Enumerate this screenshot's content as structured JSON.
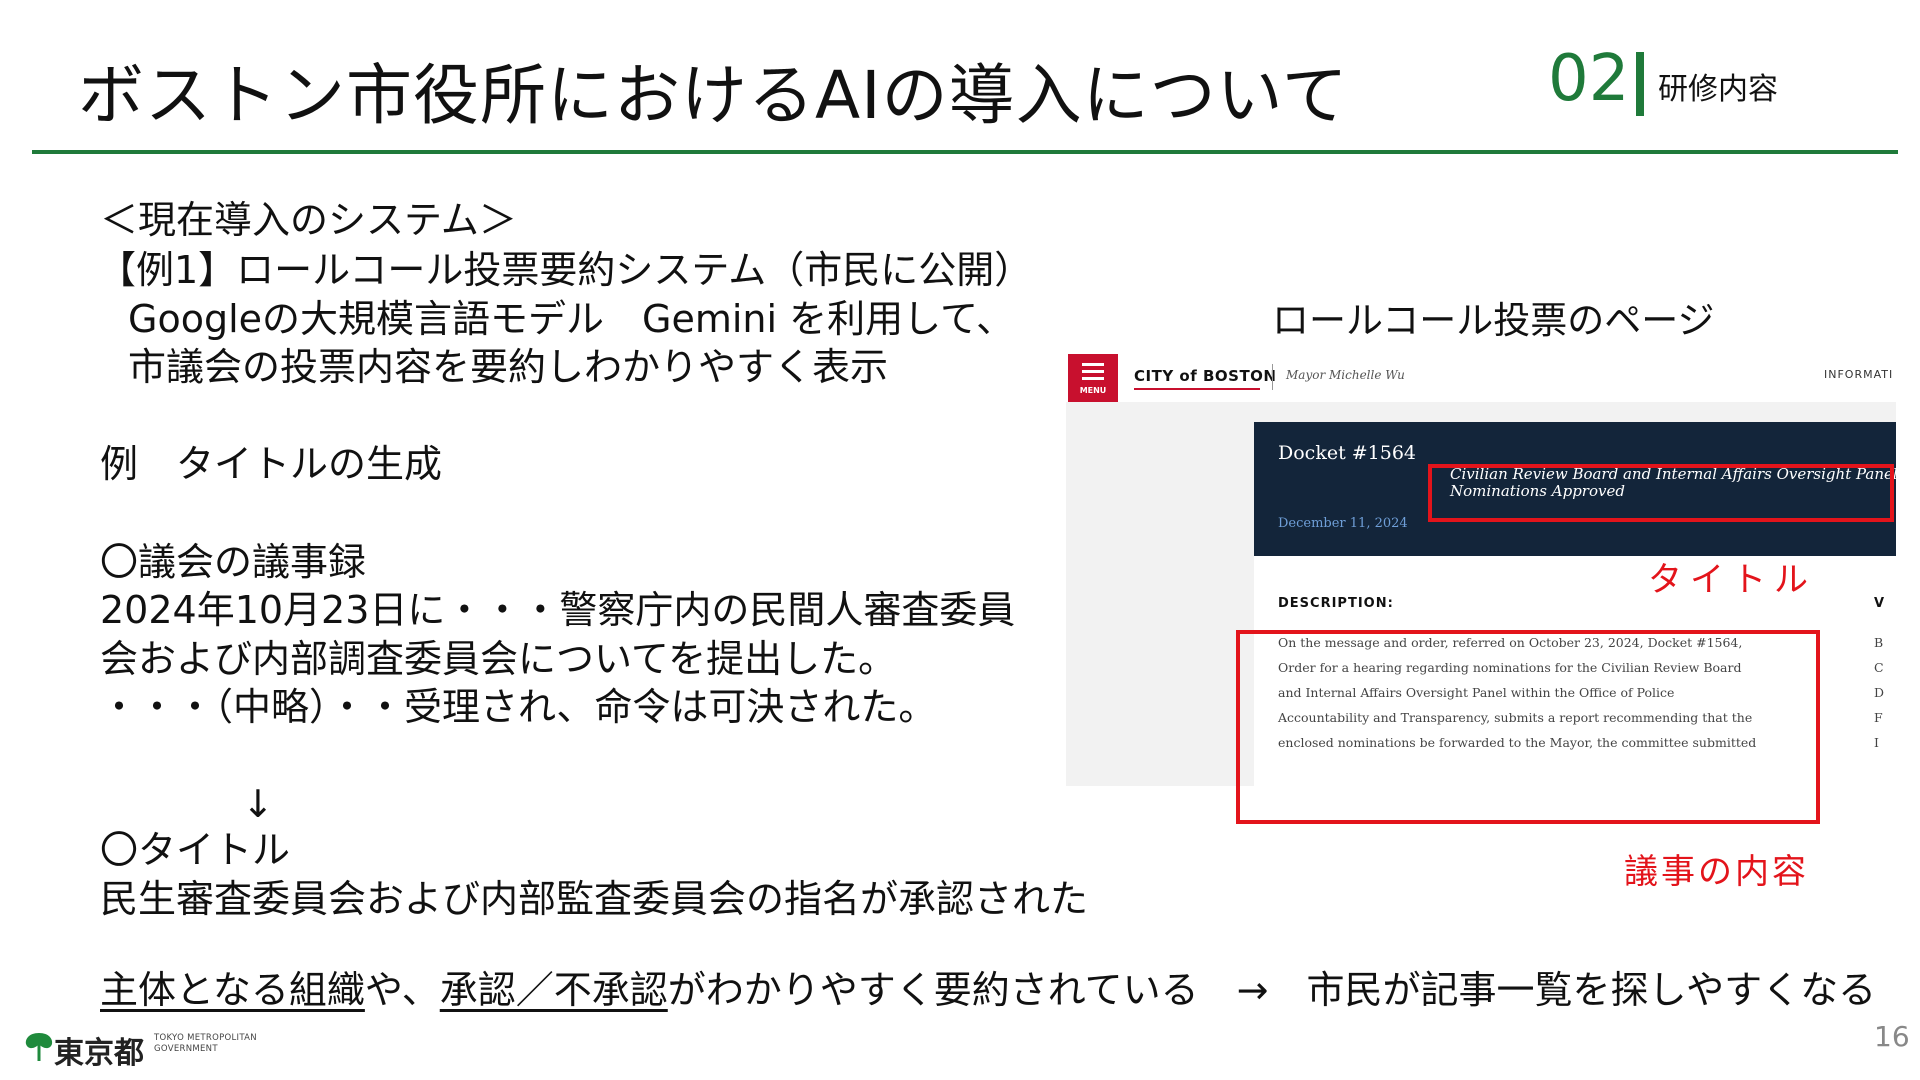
{
  "header": {
    "title": "ボストン市役所におけるAIの導入について",
    "section_number": "02",
    "section_label": "研修内容"
  },
  "body": {
    "heading": "＜現在導入のシステム＞",
    "example1_title": "【例1】ロールコール投票要約システム（市民に公開）",
    "example1_desc_1": "Googleの大規模言語モデル　Gemini を利用して、",
    "example1_desc_2": "市議会の投票内容を要約しわかりやすく表示",
    "example_label": "例　タイトルの生成",
    "minutes_heading": "〇議会の議事録",
    "minutes_line_1": "2024年10月23日に・・・警察庁内の民間人審査委員",
    "minutes_line_2": "会および内部調査委員会についてを提出した。",
    "minutes_line_3": "・・・（中略）・・受理され、命令は可決された。",
    "arrow": "↓",
    "title_heading": "〇タイトル",
    "title_result": "民生審査委員会および内部監査委員会の指名が承認された",
    "conclusion": {
      "part1": "主体となる組織",
      "part2": "や、",
      "part3": "承認／不承認",
      "part4": "がわかりやすく要約されている　→　市民が記事一覧を探しやすくなる"
    }
  },
  "screenshot": {
    "caption": "ロールコール投票のページ",
    "menu_label": "MENU",
    "site_logo": "CITY of BOSTON",
    "mayor": "Mayor Michelle Wu",
    "info": "INFORMATI",
    "docket_title": "Docket #1564",
    "docket_subject_1": "Civilian Review Board and Internal Affairs Oversight Panel",
    "docket_subject_2": "Nominations Approved",
    "docket_date": "December 11, 2024",
    "description_heading": "DESCRIPTION:",
    "side_heading": "V",
    "description_lines": [
      "On the message and order, referred on October 23, 2024, Docket #1564,",
      "Order for a hearing regarding nominations for the Civilian Review Board",
      "and Internal Affairs Oversight Panel within the Office of Police",
      "Accountability and Transparency, submits a report recommending that the",
      "enclosed nominations be forwarded to the Mayor, the committee submitted"
    ],
    "side_letters": [
      "B",
      "C",
      "D",
      "F",
      "I"
    ],
    "title_caption": "タイトル",
    "body_caption": "議事の内容"
  },
  "footer": {
    "org_name": "東京都",
    "org_en_1": "TOKYO METROPOLITAN",
    "org_en_2": "GOVERNMENT",
    "page_number": "16"
  },
  "colors": {
    "accent_green": "#1f7a3a",
    "highlight_red": "#e3141b",
    "boston_red": "#c8102e",
    "boston_navy": "#13253a"
  }
}
